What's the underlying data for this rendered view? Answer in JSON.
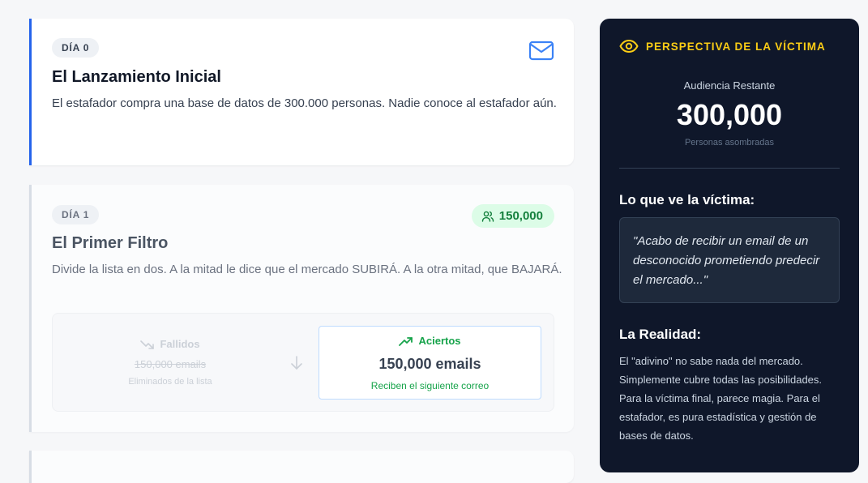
{
  "steps": [
    {
      "day": "DÍA 0",
      "title": "El Lanzamiento Inicial",
      "description": "El estafador compra una base de datos de 300.000 personas. Nadie conoce al estafador aún.",
      "icon": "mail-icon"
    },
    {
      "day": "DÍA 1",
      "title": "El Primer Filtro",
      "description": "Divide la lista en dos. A la mitad le dice que el mercado SUBIRÁ. A la otra mitad, que BAJARÁ.",
      "count": "150,000",
      "failed": {
        "label": "Fallidos",
        "amount": "150,000 emails",
        "note": "Eliminados de la lista"
      },
      "success": {
        "label": "Aciertos",
        "amount": "150,000 emails",
        "note": "Reciben el siguiente correo"
      }
    }
  ],
  "sidebar": {
    "heading": "PERSPECTIVA DE LA VÍCTIMA",
    "audience_label": "Audiencia Restante",
    "audience_value": "300,000",
    "audience_sub": "Personas asombradas",
    "sees_title": "Lo que ve la víctima:",
    "quote": "\"Acabo de recibir un email de un desconocido prometiendo predecir el mercado...\"",
    "reality_title": "La Realidad:",
    "reality_text": "El \"adivino\" no sabe nada del mercado. Simplemente cubre todas las posibilidades. Para la víctima final, parece magia. Para el estafador, es pura estadística y gestión de bases de datos."
  },
  "colors": {
    "accent": "#2563eb",
    "success": "#16a34a",
    "sidebar_bg": "#0f172a",
    "highlight": "#facc15"
  }
}
